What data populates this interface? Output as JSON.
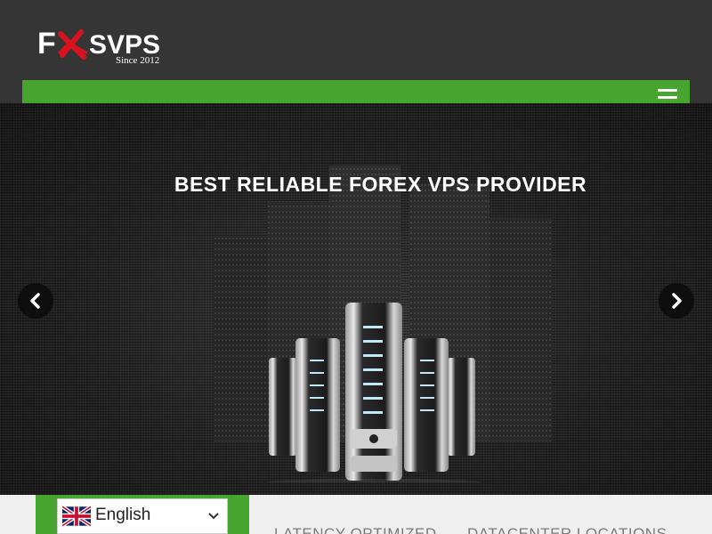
{
  "header": {
    "logo": {
      "text": "FXSVPS",
      "tagline": "Since 2012"
    },
    "nav": {
      "menu_icon": "hamburger-menu-icon"
    }
  },
  "hero": {
    "title": "BEST RELIABLE FOREX VPS PROVIDER",
    "prev_icon": "chevron-left-icon",
    "next_icon": "chevron-right-icon",
    "image": "server-stack-image"
  },
  "bottom": {
    "language": {
      "selected": "English",
      "flag_icon": "uk-flag-icon",
      "dropdown_icon": "chevron-down-icon"
    },
    "links": [
      "LATENCY OPTIMIZED",
      "DATACENTER LOCATIONS"
    ]
  },
  "colors": {
    "accent_green": "#47a42f",
    "header_bg": "#353535",
    "logo_red": "#d9121d",
    "bottom_bg": "#efefef"
  }
}
